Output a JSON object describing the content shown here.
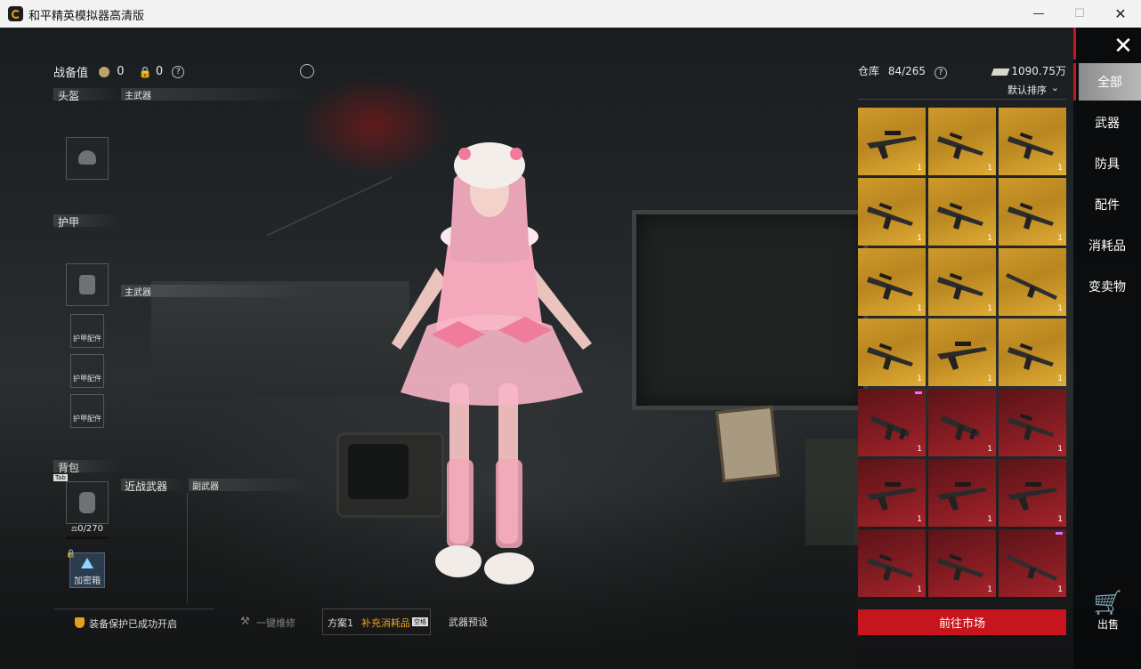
{
  "window": {
    "title": "和平精英模拟器高清版"
  },
  "left_panel": {
    "combat_value_label": "战备值",
    "combat_value": "0",
    "lock_value": "0",
    "help": "?",
    "sections": {
      "helmet": "头盔",
      "primary_weapon_1": "主武器",
      "armor": "护甲",
      "primary_weapon_2": "主武器",
      "armor_part": "护甲配件",
      "backpack": "背包",
      "backpack_tab": "Tab",
      "backpack_capacity": "0/270",
      "melee": "近战武器",
      "secondary": "副武器",
      "safebox": "加密箱"
    }
  },
  "bottom_bar": {
    "protection": "装备保护已成功开启",
    "repair": "一键维修",
    "plan": "方案1",
    "supply": "补充消耗品",
    "supply_badge": "空格",
    "preset": "武器预设"
  },
  "warehouse": {
    "label": "仓库",
    "count": "84/265",
    "help": "?",
    "money": "1090.75万",
    "sort": "默认排序",
    "items": [
      {
        "color": "gold",
        "qty": "1",
        "icon": "sniper-rifle-icon"
      },
      {
        "color": "gold",
        "qty": "1",
        "icon": "assault-rifle-icon"
      },
      {
        "color": "gold",
        "qty": "1",
        "icon": "assault-rifle-icon"
      },
      {
        "color": "gold",
        "qty": "1",
        "icon": "assault-rifle-icon"
      },
      {
        "color": "gold",
        "qty": "1",
        "icon": "assault-rifle-icon"
      },
      {
        "color": "gold",
        "qty": "1",
        "icon": "assault-rifle-icon"
      },
      {
        "color": "gold",
        "qty": "1",
        "icon": "assault-rifle-icon"
      },
      {
        "color": "gold",
        "qty": "1",
        "icon": "assault-rifle-icon"
      },
      {
        "color": "gold",
        "qty": "1",
        "icon": "marksman-rifle-icon"
      },
      {
        "color": "gold",
        "qty": "1",
        "icon": "assault-rifle-icon"
      },
      {
        "color": "gold",
        "qty": "1",
        "icon": "sniper-rifle-icon"
      },
      {
        "color": "gold",
        "qty": "1",
        "icon": "assault-rifle-icon"
      },
      {
        "color": "red",
        "qty": "1",
        "icon": "smg-icon",
        "tag": true
      },
      {
        "color": "red",
        "qty": "1",
        "icon": "smg-icon"
      },
      {
        "color": "red",
        "qty": "1",
        "icon": "assault-rifle-icon"
      },
      {
        "color": "red",
        "qty": "1",
        "icon": "sniper-rifle-icon"
      },
      {
        "color": "red",
        "qty": "1",
        "icon": "sniper-rifle-icon"
      },
      {
        "color": "red",
        "qty": "1",
        "icon": "sniper-rifle-icon"
      },
      {
        "color": "red",
        "qty": "1",
        "icon": "assault-rifle-icon"
      },
      {
        "color": "red",
        "qty": "1",
        "icon": "assault-rifle-icon"
      },
      {
        "color": "red",
        "qty": "1",
        "icon": "marksman-rifle-icon",
        "tag": true
      }
    ],
    "market_button": "前往市场"
  },
  "side_tabs": [
    {
      "label": "全部",
      "active": true
    },
    {
      "label": "武器"
    },
    {
      "label": "防具"
    },
    {
      "label": "配件"
    },
    {
      "label": "消耗品"
    },
    {
      "label": "变卖物"
    }
  ],
  "sell_label": "出售",
  "colors": {
    "accent_red": "#c6151c",
    "gold": "#d4a12a",
    "crimson": "#7a1a20"
  }
}
